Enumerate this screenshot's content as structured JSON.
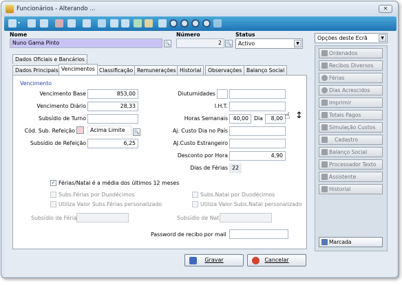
{
  "window": {
    "title": "Funcionários - Alterando ...",
    "close_label": "✕"
  },
  "toolbar": {
    "icons": [
      "search-icon",
      "dropdown-arrow-icon",
      "new-doc-icon",
      "copy-doc-icon",
      "cut-icon",
      "paste-icon",
      "table-icon",
      "refresh-icon",
      "print-icon",
      "print-preview-icon",
      "export-icon",
      "attach-icon",
      "first-record-icon",
      "prev-record-icon",
      "next-record-icon",
      "last-record-icon",
      "exit-icon"
    ]
  },
  "header": {
    "name_label": "Nome",
    "name_value": "Nuno Gama Pinto",
    "number_label": "Número",
    "number_value": "2",
    "status_label": "Status",
    "status_value": "Activo"
  },
  "tabs_row1": [
    {
      "label": "Dados Oficiais e Bancários"
    }
  ],
  "tabs_row2": [
    {
      "label": "Dados Principais"
    },
    {
      "label": "Vencimentos"
    },
    {
      "label": "Classificação"
    },
    {
      "label": "Remunerações"
    },
    {
      "label": "Historial"
    },
    {
      "label": "Observações"
    },
    {
      "label": "Balanço Social"
    }
  ],
  "vencimento": {
    "section_title": "Vencimento",
    "base_label": "Vencimento Base",
    "base_value": "853,00",
    "diario_label": "Vencimento Diário",
    "diario_value": "28,33",
    "turno_label": "Subsídio de Turno",
    "turno_value": "",
    "cod_sub_label": "Cód. Sub. Refeição",
    "cod_sub_value": "Acima Limite",
    "sub_ref_label": "Subsídio de Refeição",
    "sub_ref_value": "6,25",
    "diut_label": "Diuturnidades",
    "diut_value": "",
    "iht_label": "I.H.T.",
    "iht_value": "",
    "horas_label": "Horas Semanais",
    "horas_value": "40,00",
    "dia_label": "Dia",
    "dia_value": "8,00",
    "aj_pais_label": "Aj. Custo Dia no País",
    "aj_pais_value": "",
    "aj_estr_label": "AJ.Custo Estrangeiro",
    "aj_estr_value": "",
    "desc_hora_label": "Desconto por Hora",
    "desc_hora_value": "4,90",
    "dias_ferias_label": "Dias de Férias",
    "dias_ferias_value": "22"
  },
  "options": {
    "ferias_media_label": "Férias/Natal é a média dos últimos 12 meses",
    "subs_ferias_duod_label": "Subs.Férias por Duodécimos",
    "subs_natal_duod_label": "Subs.Natal por Duodécimos",
    "valor_ferias_label": "Utiliza Valor Subs.Férias personalizado",
    "valor_natal_label": "Utiliza Valor Subs.Natal personalizado",
    "sub_ferias_label": "Subsídio de Férias",
    "sub_natal_label": "Subsídio de Natal",
    "password_label": "Password de recibo por mail"
  },
  "sidebar": {
    "options_select": "Opções deste Ecrã",
    "items": [
      {
        "label": "Ordenados"
      },
      {
        "label": "Recibos Diversos"
      },
      {
        "label": "Férias"
      },
      {
        "label": "Dias Acrescidos"
      },
      {
        "label": "Imprimir"
      },
      {
        "label": "Totais Pagos"
      },
      {
        "label": "Simulação Custos"
      },
      {
        "label": "Cadastro"
      },
      {
        "label": "Balanço Social"
      },
      {
        "label": "Processador Texto"
      },
      {
        "label": "Assistente"
      },
      {
        "label": "Historial"
      }
    ],
    "marcada_label": "Marcada"
  },
  "footer": {
    "gravar_label": "Gravar",
    "cancelar_label": "Cancelar"
  },
  "colors": {
    "toolbar": "#2b8ccc",
    "name_highlight": "#c9c3f5",
    "section_title": "#2a3fa8"
  }
}
